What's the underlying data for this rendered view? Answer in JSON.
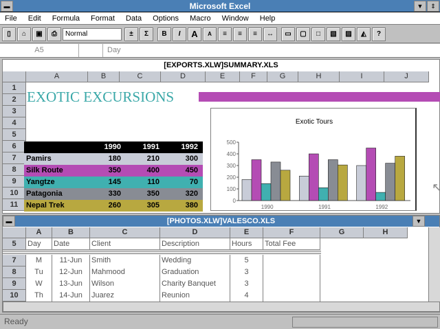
{
  "app": {
    "title": "Microsoft Excel"
  },
  "menu": [
    "File",
    "Edit",
    "Formula",
    "Format",
    "Data",
    "Options",
    "Macro",
    "Window",
    "Help"
  ],
  "toolbar": {
    "style": "Normal",
    "buttons": [
      "new-icon",
      "open-icon",
      "save-icon",
      "print-icon",
      "plus",
      "sum",
      "B",
      "I",
      "A+",
      "A-",
      "align-left",
      "align-center",
      "align-right",
      "center-across",
      "border-outline",
      "border-bottom",
      "border-box",
      "copy-pic",
      "paste-pic",
      "chart-wizard",
      "help"
    ],
    "sum_label": "Σ",
    "bold_label": "B",
    "italic_label": "I",
    "grow_label": "A",
    "shrink_label": "A"
  },
  "formula_bar": {
    "cell_ref": "A5",
    "content": "Day"
  },
  "window1": {
    "title": "[EXPORTS.XLW]SUMMARY.XLS",
    "columns": [
      "A",
      "B",
      "C",
      "D",
      "E",
      "F",
      "G",
      "H",
      "I",
      "J"
    ],
    "rows": [
      "1",
      "2",
      "3",
      "4",
      "5",
      "6",
      "7",
      "8",
      "9",
      "10",
      "11"
    ],
    "heading": "EXOTIC EXCURSIONS",
    "table": {
      "years": [
        "1990",
        "1991",
        "1992"
      ],
      "rows": [
        {
          "name": "Pamirs",
          "values": [
            "180",
            "210",
            "300"
          ],
          "color": "#c8ccd8"
        },
        {
          "name": "Silk Route",
          "values": [
            "350",
            "400",
            "450"
          ],
          "color": "#b44cb4"
        },
        {
          "name": "Yangtze",
          "values": [
            "145",
            "110",
            "70"
          ],
          "color": "#40b0b0"
        },
        {
          "name": "Patagonia",
          "values": [
            "330",
            "350",
            "320"
          ],
          "color": "#888c94"
        },
        {
          "name": "Nepal Trek",
          "values": [
            "260",
            "305",
            "380"
          ],
          "color": "#b8a840"
        }
      ]
    }
  },
  "chart_data": {
    "type": "bar",
    "title": "Exotic Tours",
    "categories": [
      "1990",
      "1991",
      "1992"
    ],
    "ylim": [
      0,
      500
    ],
    "yticks": [
      "0",
      "100",
      "200",
      "300",
      "400",
      "500"
    ],
    "series": [
      {
        "name": "Pamirs",
        "values": [
          180,
          210,
          300
        ],
        "color": "#c8ccd8"
      },
      {
        "name": "Silk Route",
        "values": [
          350,
          400,
          450
        ],
        "color": "#b44cb4"
      },
      {
        "name": "Yangtze",
        "values": [
          145,
          110,
          70
        ],
        "color": "#40b0b0"
      },
      {
        "name": "Patagonia",
        "values": [
          330,
          350,
          320
        ],
        "color": "#888c94"
      },
      {
        "name": "Nepal Trek",
        "values": [
          260,
          305,
          380
        ],
        "color": "#b8a840"
      }
    ]
  },
  "window2": {
    "title": "[PHOTOS.XLW]VALESCO.XLS",
    "columns": [
      "A",
      "B",
      "C",
      "D",
      "E",
      "F",
      "G",
      "H"
    ],
    "header_row": "5",
    "headers": [
      "Day",
      "Date",
      "Client",
      "Description",
      "Hours",
      "Total Fee"
    ],
    "rows": [
      {
        "n": "7",
        "cells": [
          "M",
          "11-Jun",
          "Smith",
          "Wedding",
          "5",
          ""
        ]
      },
      {
        "n": "8",
        "cells": [
          "Tu",
          "12-Jun",
          "Mahmood",
          "Graduation",
          "3",
          ""
        ]
      },
      {
        "n": "9",
        "cells": [
          "W",
          "13-Jun",
          "Wilson",
          "Charity Banquet",
          "3",
          ""
        ]
      },
      {
        "n": "10",
        "cells": [
          "Th",
          "14-Jun",
          "Juarez",
          "Reunion",
          "4",
          ""
        ]
      }
    ]
  },
  "status": {
    "text": "Ready"
  }
}
